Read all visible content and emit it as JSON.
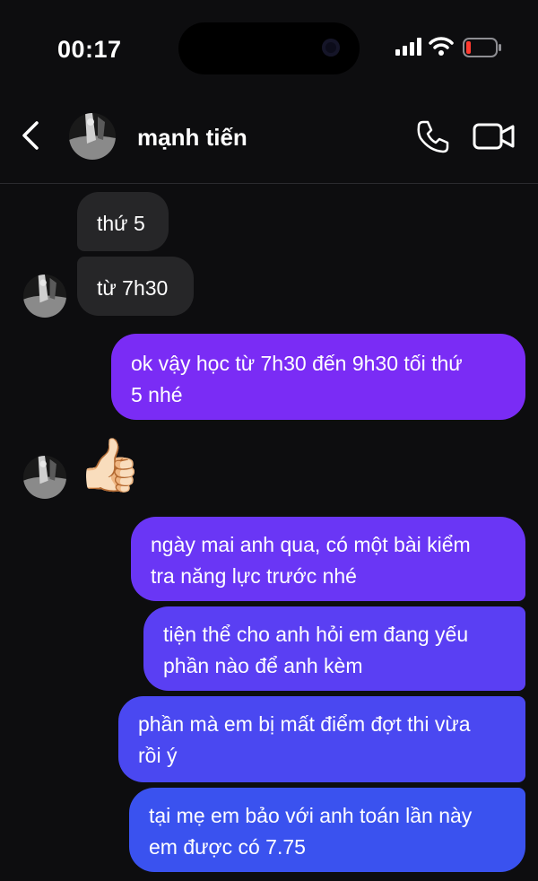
{
  "status": {
    "time": "00:17"
  },
  "header": {
    "contact_name": "mạnh tiến"
  },
  "messages": {
    "m1": "thứ 5",
    "m2": "từ 7h30",
    "m3_line1": "ok vậy học từ 7h30 đến 9h30 tối thứ",
    "m3_line2": "5 nhé",
    "m4_reaction": "👍🏻",
    "m5_line1": "ngày mai anh qua, có một bài kiểm",
    "m5_line2": "tra năng lực trước nhé",
    "m6_line1": "tiện thể cho anh hỏi em đang yếu",
    "m6_line2": "phần nào để anh kèm",
    "m7_line1": "phần mà em bị mất điểm đợt thi vừa",
    "m7_line2": "rồi ý",
    "m8_line1": "tại mẹ em bảo với anh toán lần này",
    "m8_line2": "em được có 7.75"
  },
  "icons": {
    "back": "chevron-left-icon",
    "call": "phone-icon",
    "video": "video-camera-icon",
    "signal": "cellular-signal-icon",
    "wifi": "wifi-icon",
    "battery": "battery-low-icon"
  },
  "colors": {
    "background": "#0d0d0f",
    "incoming_bubble": "#262628",
    "outgoing_top": "#7a2cf5",
    "outgoing_bottom": "#3a52ef",
    "battery_low": "#ff3b30"
  }
}
